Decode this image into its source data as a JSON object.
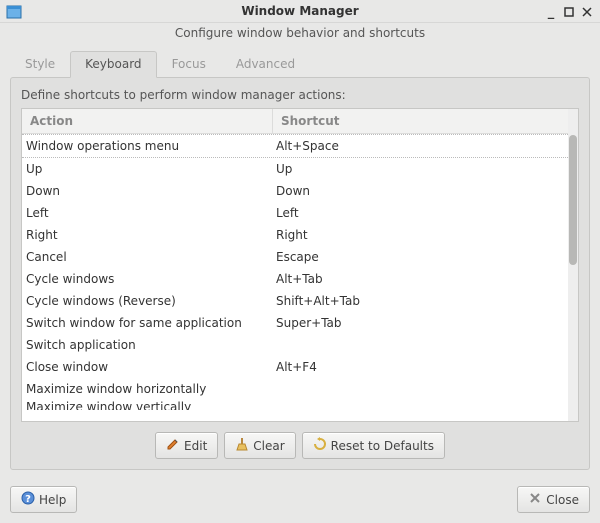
{
  "header": {
    "title": "Window Manager",
    "subtitle": "Configure window behavior and shortcuts"
  },
  "tabs": [
    {
      "label": "Style"
    },
    {
      "label": "Keyboard"
    },
    {
      "label": "Focus"
    },
    {
      "label": "Advanced"
    }
  ],
  "active_tab_index": 1,
  "instruction": "Define shortcuts to perform window manager actions:",
  "columns": {
    "action": "Action",
    "shortcut": "Shortcut"
  },
  "shortcuts": [
    {
      "action": "Window operations menu",
      "shortcut": "Alt+Space"
    },
    {
      "action": "Up",
      "shortcut": "Up"
    },
    {
      "action": "Down",
      "shortcut": "Down"
    },
    {
      "action": "Left",
      "shortcut": "Left"
    },
    {
      "action": "Right",
      "shortcut": "Right"
    },
    {
      "action": "Cancel",
      "shortcut": "Escape"
    },
    {
      "action": "Cycle windows",
      "shortcut": "Alt+Tab"
    },
    {
      "action": "Cycle windows (Reverse)",
      "shortcut": "Shift+Alt+Tab"
    },
    {
      "action": "Switch window for same application",
      "shortcut": "Super+Tab"
    },
    {
      "action": "Switch application",
      "shortcut": ""
    },
    {
      "action": "Close window",
      "shortcut": "Alt+F4"
    },
    {
      "action": "Maximize window horizontally",
      "shortcut": ""
    },
    {
      "action": "Maximize window vertically",
      "shortcut": ""
    }
  ],
  "buttons": {
    "edit": "Edit",
    "clear": "Clear",
    "reset": "Reset to Defaults",
    "help": "Help",
    "close": "Close"
  },
  "window_controls": {
    "minimize": "_",
    "maximize": "□",
    "close": "✕"
  }
}
